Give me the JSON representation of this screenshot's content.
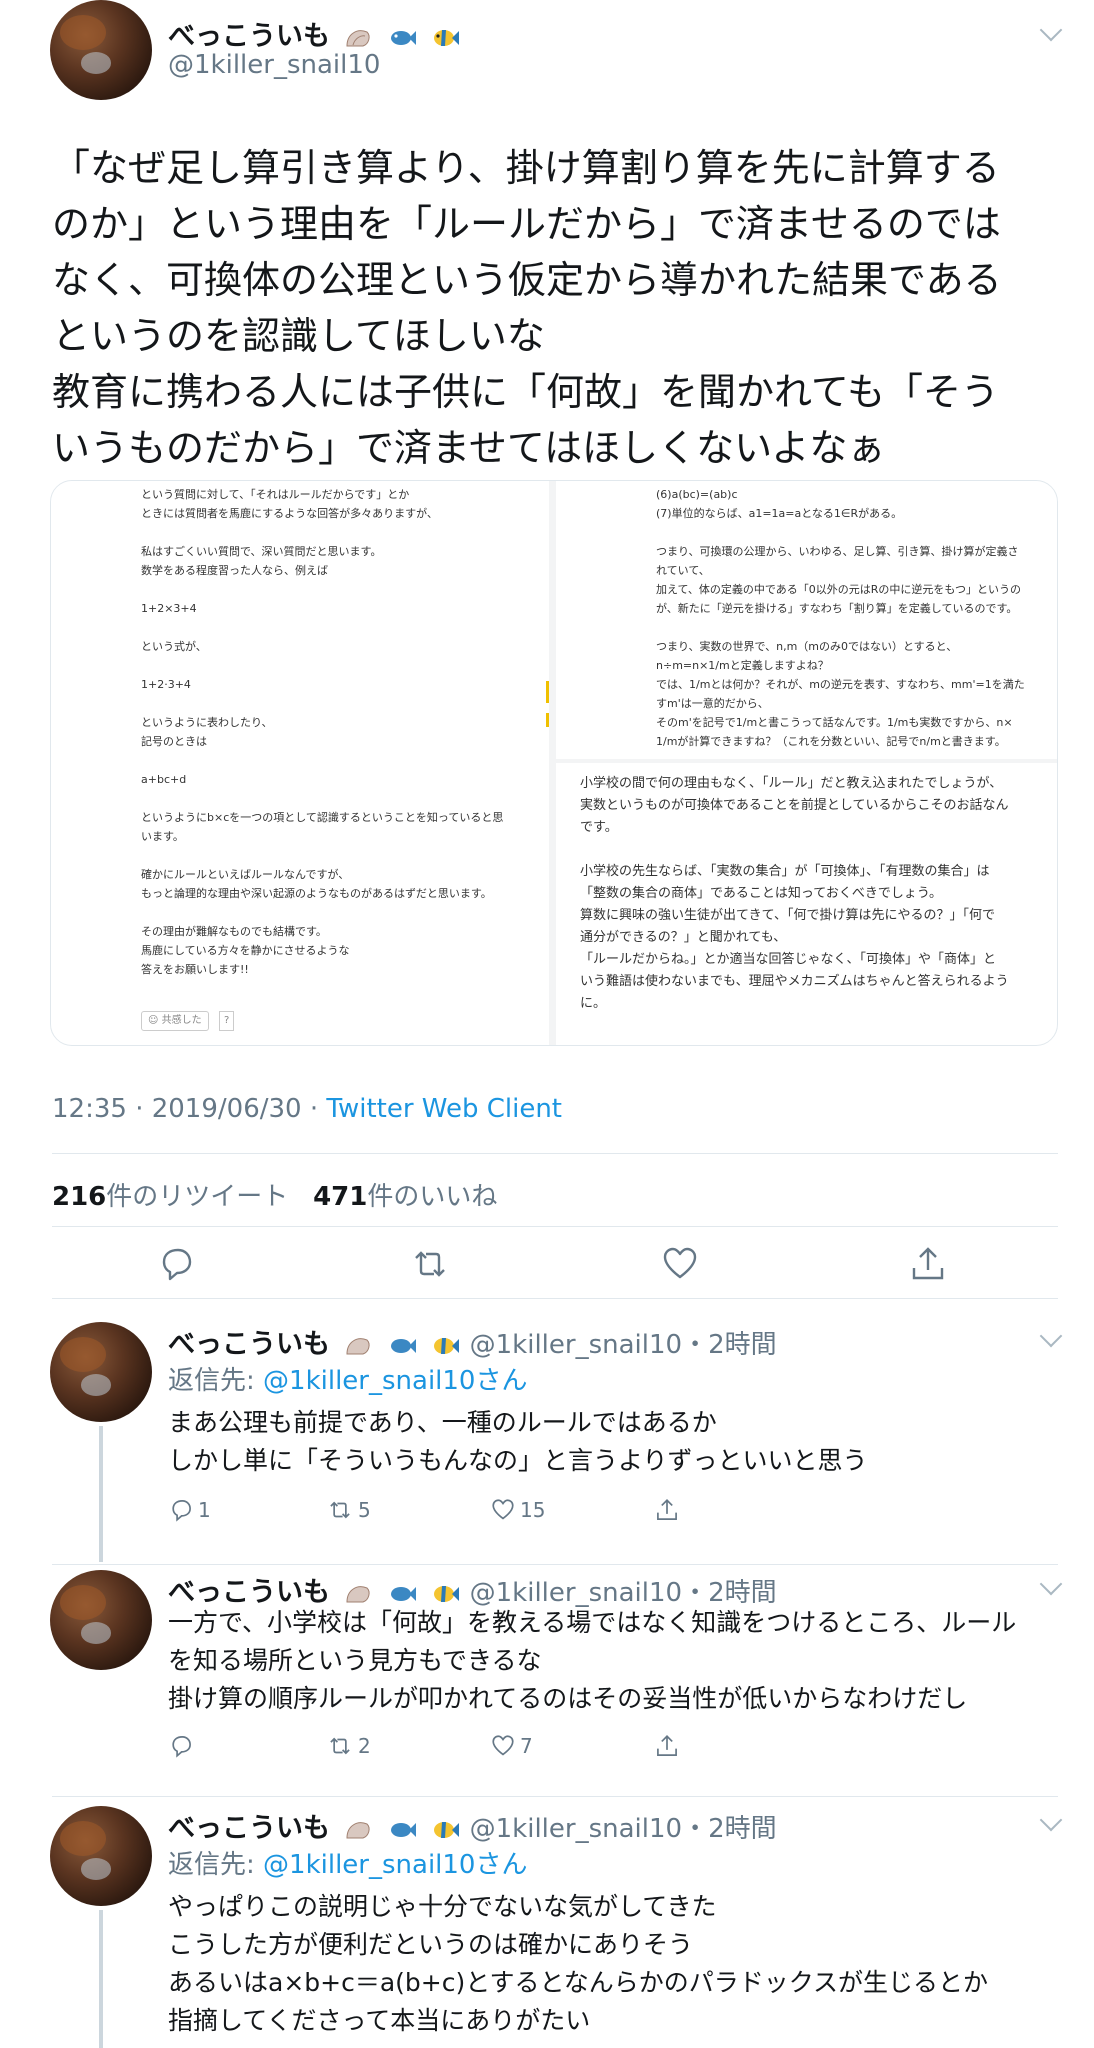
{
  "main_tweet": {
    "author_name": "べっこういも",
    "author_emojis": [
      "shell-emoji",
      "fish-emoji",
      "tropical-fish-emoji"
    ],
    "author_handle": "@1killer_snail10",
    "text_lines": [
      "「なぜ足し算引き算より、掛け算割り算を先に計算する",
      "のか」という理由を「ルールだから」で済ませるのでは",
      "なく、可換体の公理という仮定から導かれた結果である",
      "というのを認識してほしいな",
      "教育に携わる人には子供に「何故」を聞かれても「そう",
      "いうものだから」で済ませてはほしくないよなぁ"
    ],
    "time": "12:35 · 2019/06/30 · ",
    "client": "Twitter Web Client",
    "retweet_count": "216",
    "retweet_label": "件のリツイート",
    "like_count": "471",
    "like_label": "件のいいね"
  },
  "media": {
    "left_panel": [
      "という質問に対して、「それはルールだからです」とか",
      "ときには質問者を馬鹿にするような回答が多々ありますが、",
      "",
      "私はすごくいい質問で、深い質問だと思います。",
      "数学をある程度習った人なら、例えば",
      "",
      "1+2×3+4",
      "",
      "という式が、",
      "",
      "1+2·3+4",
      "",
      "というように表わしたり、",
      "記号のときは",
      "",
      "a+bc+d",
      "",
      "というようにb×cを一つの項として認識するということを知っていると思",
      "います。",
      "",
      "確かにルールといえばルールなんですが、",
      "もっと論理的な理由や深い起源のようなものがあるはずだと思います。",
      "",
      "その理由が難解なものでも結構です。",
      "馬鹿にしている方々を静かにさせるような",
      "答えをお願いします!!"
    ],
    "left_footer": "共感した",
    "left_footer_count": "?",
    "right_top_panel": [
      "(6)a(bc)=(ab)c",
      "(7)単位的ならば、a1=1a=aとなる1∈Rがある。",
      "",
      "つまり、可換環の公理から、いわゆる、足し算、引き算、掛け算が定義さ",
      "れていて、",
      "加えて、体の定義の中である「0以外の元はRの中に逆元をもつ」というの",
      "が、新たに「逆元を掛ける」すなわち「割り算」を定義しているのです。",
      "",
      "つまり、実数の世界で、n,m（mのみ0ではない）とすると、",
      "n÷m=n×1/mと定義しますよね？",
      "では、1/mとは何か？それが、mの逆元を表す、すなわち、mm'=1を満た",
      "すm'は一意的だから、",
      "そのm'を記号で1/mと書こうって話なんです。1/mも実数ですから、n×",
      "1/mが計算できますね？（これを分数といい、記号でn/mと書きます。"
    ],
    "right_bottom_panel": [
      "小学校の間で何の理由もなく、「ルール」だと教え込まれたでしょうが、",
      "実数というものが可換体であることを前提としているからこそのお話なん",
      "です。",
      "",
      "小学校の先生ならば、「実数の集合」が「可換体」、「有理数の集合」は",
      "「整数の集合の商体」であることは知っておくべきでしょう。",
      "算数に興味の強い生徒が出てきて、「何で掛け算は先にやるの？」「何で",
      "通分ができるの？」と聞かれても、",
      "「ルールだからね。」とか適当な回答じゃなく、「可換体」や「商体」と",
      "いう難語は使わないまでも、理屈やメカニズムはちゃんと答えられるよう",
      "に。"
    ]
  },
  "replies": [
    {
      "author_name": "べっこういも",
      "author_handle_time": "@1killer_snail10・2時間",
      "reply_to_label": "返信先: ",
      "reply_to_user": "@1killer_snail10さん",
      "text_lines": [
        "まあ公理も前提であり、一種のルールではあるか",
        "しかし単に「そういうもんなの」と言うよりずっといいと思う"
      ],
      "reply_count": "1",
      "retweet_count": "5",
      "like_count": "15"
    },
    {
      "author_name": "べっこういも",
      "author_handle_time": "@1killer_snail10・2時間",
      "text_lines": [
        "一方で、小学校は「何故」を教える場ではなく知識をつけるところ、ルール",
        "を知る場所という見方もできるな",
        "掛け算の順序ルールが叩かれてるのはその妥当性が低いからなわけだし"
      ],
      "reply_count": "",
      "retweet_count": "2",
      "like_count": "7"
    },
    {
      "author_name": "べっこういも",
      "author_handle_time": "@1killer_snail10・2時間",
      "reply_to_label": "返信先: ",
      "reply_to_user": "@1killer_snail10さん",
      "text_lines": [
        "やっぱりこの説明じゃ十分でないな気がしてきた",
        "こうした方が便利だというのは確かにありそう",
        "あるいはa×b+c＝a(b+c)とするとなんらかのパラドックスが生じるとか",
        "指摘してくださって本当にありがたい"
      ]
    }
  ],
  "colors": {
    "link": "#1b95e0",
    "secondary_text": "#657786",
    "primary_text": "#14171a",
    "divider": "#e1e8ed",
    "thread_line": "#ccd6dd"
  }
}
